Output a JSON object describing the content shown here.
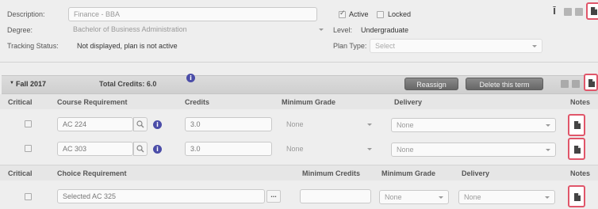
{
  "plan": {
    "description_label": "Description:",
    "description_value": "Finance - BBA",
    "active_label": "Active",
    "locked_label": "Locked",
    "degree_label": "Degree:",
    "degree_value": "Bachelor of Business Administration",
    "level_label": "Level:",
    "level_value": "Undergraduate",
    "tracking_label": "Tracking Status:",
    "tracking_value": "Not displayed, plan is not active",
    "plan_type_label": "Plan Type:",
    "plan_type_value": "Select",
    "active_checked": true,
    "locked_checked": false
  },
  "term": {
    "title": "Fall 2017",
    "total_credits": "Total Credits: 6.0",
    "reassign_label": "Reassign",
    "delete_label": "Delete this term"
  },
  "course_table": {
    "headers": {
      "critical": "Critical",
      "requirement": "Course Requirement",
      "credits": "Credits",
      "min_grade": "Minimum Grade",
      "delivery": "Delivery",
      "notes": "Notes"
    },
    "rows": [
      {
        "course": "AC 224",
        "credits": "3.0",
        "min_grade": "None",
        "delivery": "None"
      },
      {
        "course": "AC 303",
        "credits": "3.0",
        "min_grade": "None",
        "delivery": "None"
      }
    ]
  },
  "choice_table": {
    "headers": {
      "critical": "Critical",
      "requirement": "Choice Requirement",
      "min_credits": "Minimum Credits",
      "min_grade": "Minimum Grade",
      "delivery": "Delivery",
      "notes": "Notes"
    },
    "rows": [
      {
        "selected": "Selected  AC 325",
        "ellipsis": "...",
        "min_credits": "",
        "min_grade": "None",
        "delivery": "None"
      }
    ]
  },
  "icons": {
    "info": "i",
    "collapse": "▼",
    "search": "search-icon",
    "note": "note-icon"
  },
  "colors": {
    "highlight": "#e0566a",
    "info_blue": "#4b4da8",
    "background": "#eeeeee"
  }
}
